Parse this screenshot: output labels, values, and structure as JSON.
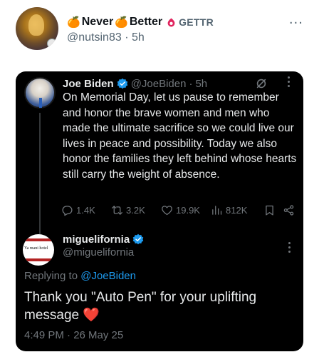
{
  "outer_post": {
    "name_part1": "Never",
    "name_part2": "Better",
    "emoji_orange": "🍊",
    "platform_label": "GETTR",
    "handle": "@nutsin83",
    "separator": "·",
    "time": "5h"
  },
  "quoted_tweet": {
    "name": "Joe Biden",
    "handle": "@JoeBiden",
    "separator": "·",
    "time": "5h",
    "text": "On Memorial Day, let us pause to remember and honor the brave women and men who made the ultimate sacrifice so we could live our lives in peace and possibility. Today we also honor the families they left behind whose hearts still carry the weight of absence.",
    "stats": {
      "replies": "1.4K",
      "reposts": "3.2K",
      "likes": "19.9K",
      "views": "812K"
    }
  },
  "reply": {
    "name": "miguelifornia",
    "handle": "@miguelifornia",
    "replying_prefix": "Replying to",
    "replying_to": "@JoeBiden",
    "text": "Thank you \"Auto Pen\" for your uplifting message",
    "emoji": "❤️",
    "timestamp": "4:49 PM · 26 May 25",
    "avatar_text": "Ya mani hotel"
  },
  "colors": {
    "accent": "#1d9bf0",
    "gettr_red": "#e0245e",
    "card_bg": "#000000",
    "muted": "#71767b"
  }
}
